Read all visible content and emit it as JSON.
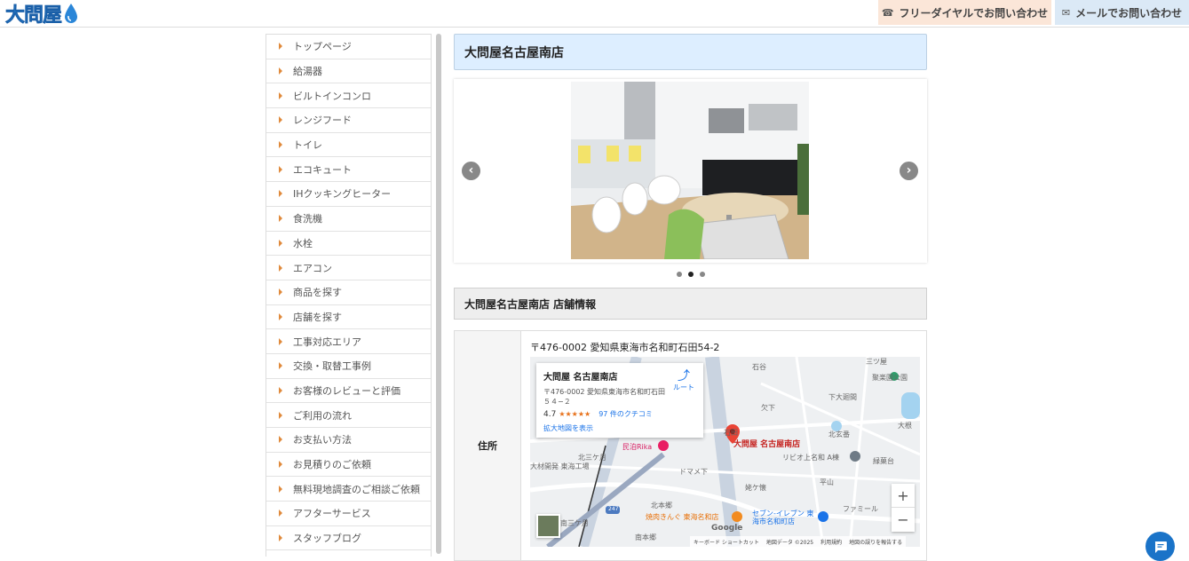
{
  "header": {
    "logo_text": "大問屋",
    "phone_label": "フリーダイヤルでお問い合わせ",
    "mail_label": "メールでお問い合わせ",
    "phone_icon": "phone-icon",
    "mail_icon": "envelope-icon"
  },
  "sidebar": {
    "items": [
      {
        "label": "トップページ"
      },
      {
        "label": "給湯器"
      },
      {
        "label": "ビルトインコンロ"
      },
      {
        "label": "レンジフード"
      },
      {
        "label": "トイレ"
      },
      {
        "label": "エコキュート"
      },
      {
        "label": "IHクッキングヒーター"
      },
      {
        "label": "食洗機"
      },
      {
        "label": "水栓"
      },
      {
        "label": "エアコン"
      },
      {
        "label": "商品を探す"
      },
      {
        "label": "店舗を探す"
      },
      {
        "label": "工事対応エリア"
      },
      {
        "label": "交換・取替工事例"
      },
      {
        "label": "お客様のレビューと評価"
      },
      {
        "label": "ご利用の流れ"
      },
      {
        "label": "お支払い方法"
      },
      {
        "label": "お見積りのご依頼"
      },
      {
        "label": "無料現地調査のご相談ご依頼"
      },
      {
        "label": "アフターサービス"
      },
      {
        "label": "スタッフブログ"
      }
    ]
  },
  "main": {
    "title": "大問屋名古屋南店",
    "carousel": {
      "prev": "‹",
      "next": "›",
      "slide_count": 3,
      "active_index": 1
    },
    "info_heading": "大問屋名古屋南店 店舗情報",
    "info": {
      "address_label": "住所",
      "address_value": "〒476-0002 愛知県東海市名和町石田54-2"
    },
    "map": {
      "card_title": "大問屋 名古屋南店",
      "card_address": "〒476-0002 愛知県東海市名和町石田５４−２",
      "route_label": "ルート",
      "rating": "4.7",
      "stars": "★★★★★",
      "reviews": "97 件のクチコミ",
      "larger_map": "拡大地図を表示",
      "pin_label": "大問屋 名古屋南店",
      "zoom_in": "+",
      "zoom_out": "−",
      "google": "Google",
      "footer_shortcuts": "キーボード ショートカット",
      "footer_data": "地図データ ©2025",
      "footer_terms": "利用規約",
      "footer_report": "地図の誤りを報告する",
      "labels": [
        "石谷",
        "三ツ屋",
        "聚楽園公園",
        "下大廻間",
        "欠下",
        "石田",
        "北玄番",
        "大根",
        "リビオ上名和 A棟",
        "緑菓台",
        "民泊Rika",
        "北三ケ月",
        "大材開発 東海工場",
        "ドマメ下",
        "姥ケ懐",
        "平山",
        "北本郷",
        "焼肉きんぐ 東海名和店",
        "セブン-イレブン 東海市名和町店",
        "南三ケ月",
        "南本郷",
        "ファミール",
        "247"
      ]
    }
  },
  "chat": {
    "icon": "chat-icon"
  },
  "colors": {
    "accent_orange": "#e08a3c",
    "title_bg": "#ddeeff",
    "phone_bg": "#fbe6d8",
    "mail_bg": "#dbe9f6",
    "logo_blue": "#2a86d8"
  }
}
